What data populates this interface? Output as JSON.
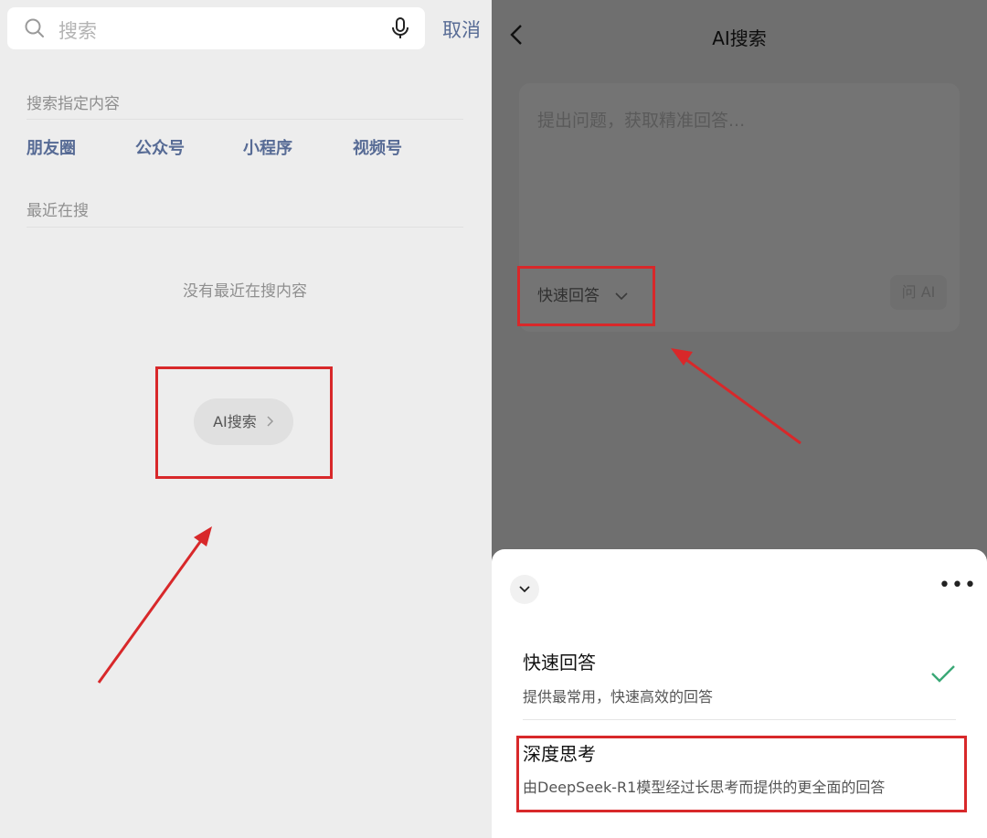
{
  "left": {
    "search": {
      "placeholder": "搜索",
      "cancel": "取消"
    },
    "scope_title": "搜索指定内容",
    "scopes": [
      "朋友圈",
      "公众号",
      "小程序",
      "视频号"
    ],
    "recent_title": "最近在搜",
    "recent_empty": "没有最近在搜内容",
    "ai_search_button": "AI搜索"
  },
  "right": {
    "title": "AI搜索",
    "question_placeholder": "提出问题，获取精准回答...",
    "mode_selected": "快速回答",
    "ask_button": "问 AI",
    "sheet": {
      "more": "•••",
      "options": [
        {
          "title": "快速回答",
          "desc": "提供最常用，快速高效的回答",
          "selected": true
        },
        {
          "title": "深度思考",
          "desc": "由DeepSeek-R1模型经过长思考而提供的更全面的回答",
          "selected": false
        }
      ]
    }
  },
  "colors": {
    "link": "#576b95",
    "annotation": "#d8282a",
    "check": "#3aa876"
  }
}
